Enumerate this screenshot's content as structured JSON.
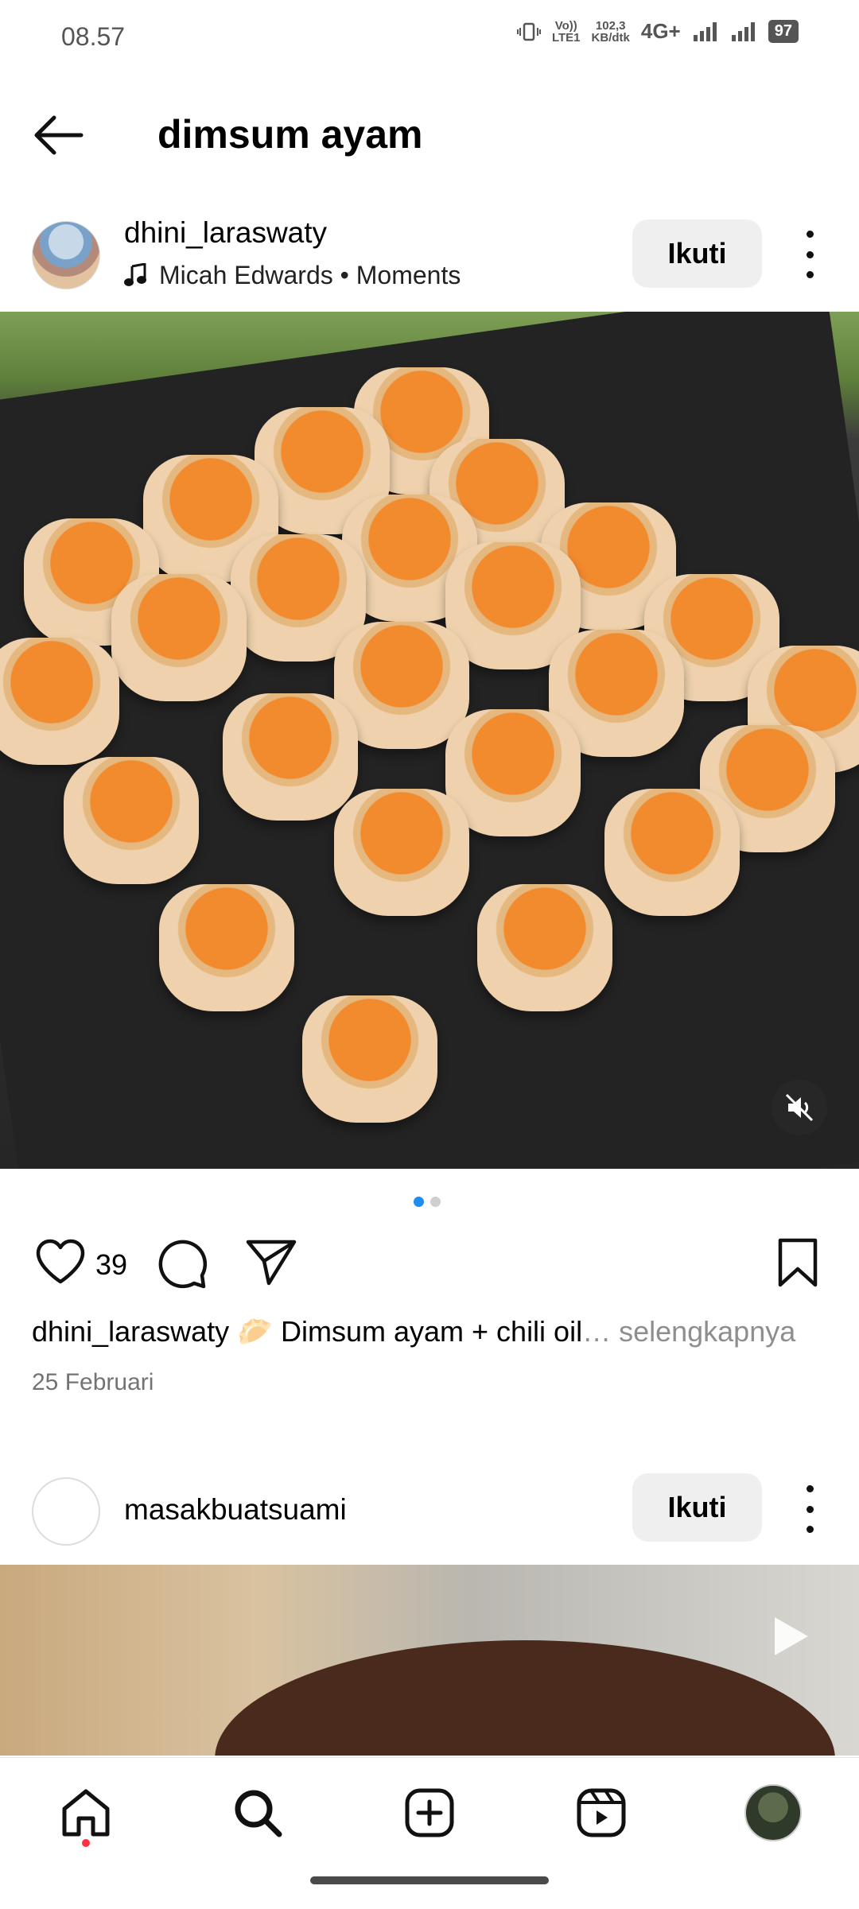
{
  "status_bar": {
    "time": "08.57",
    "volte": "Vo))",
    "lte": "LTE1",
    "speed_value": "102,3",
    "speed_unit": "KB/dtk",
    "network": "4G+",
    "battery": "97"
  },
  "header": {
    "title": "dimsum ayam",
    "back_icon": "arrow-left-icon"
  },
  "post1": {
    "username": "dhini_laraswaty",
    "music_icon": "music-note-icon",
    "music_text": "Micah Edwards • Moments",
    "follow_label": "Ikuti",
    "likes": "39",
    "caption_user": "dhini_laraswaty",
    "caption_emoji": "🥟",
    "caption_text": " Dimsum ayam + chili oil",
    "caption_more": "… selengkapnya",
    "date": "25 Februari",
    "carousel_count": 2,
    "carousel_active": 1
  },
  "post2": {
    "username": "masakbuatsuami",
    "follow_label": "Ikuti"
  },
  "bottom_nav": {
    "items": [
      "home-icon",
      "search-icon",
      "add-icon",
      "reels-icon",
      "profile-avatar"
    ]
  },
  "colors": {
    "accent_blue": "#1f8ef1",
    "notification_red": "#ff3040",
    "button_bg": "#efefef"
  }
}
